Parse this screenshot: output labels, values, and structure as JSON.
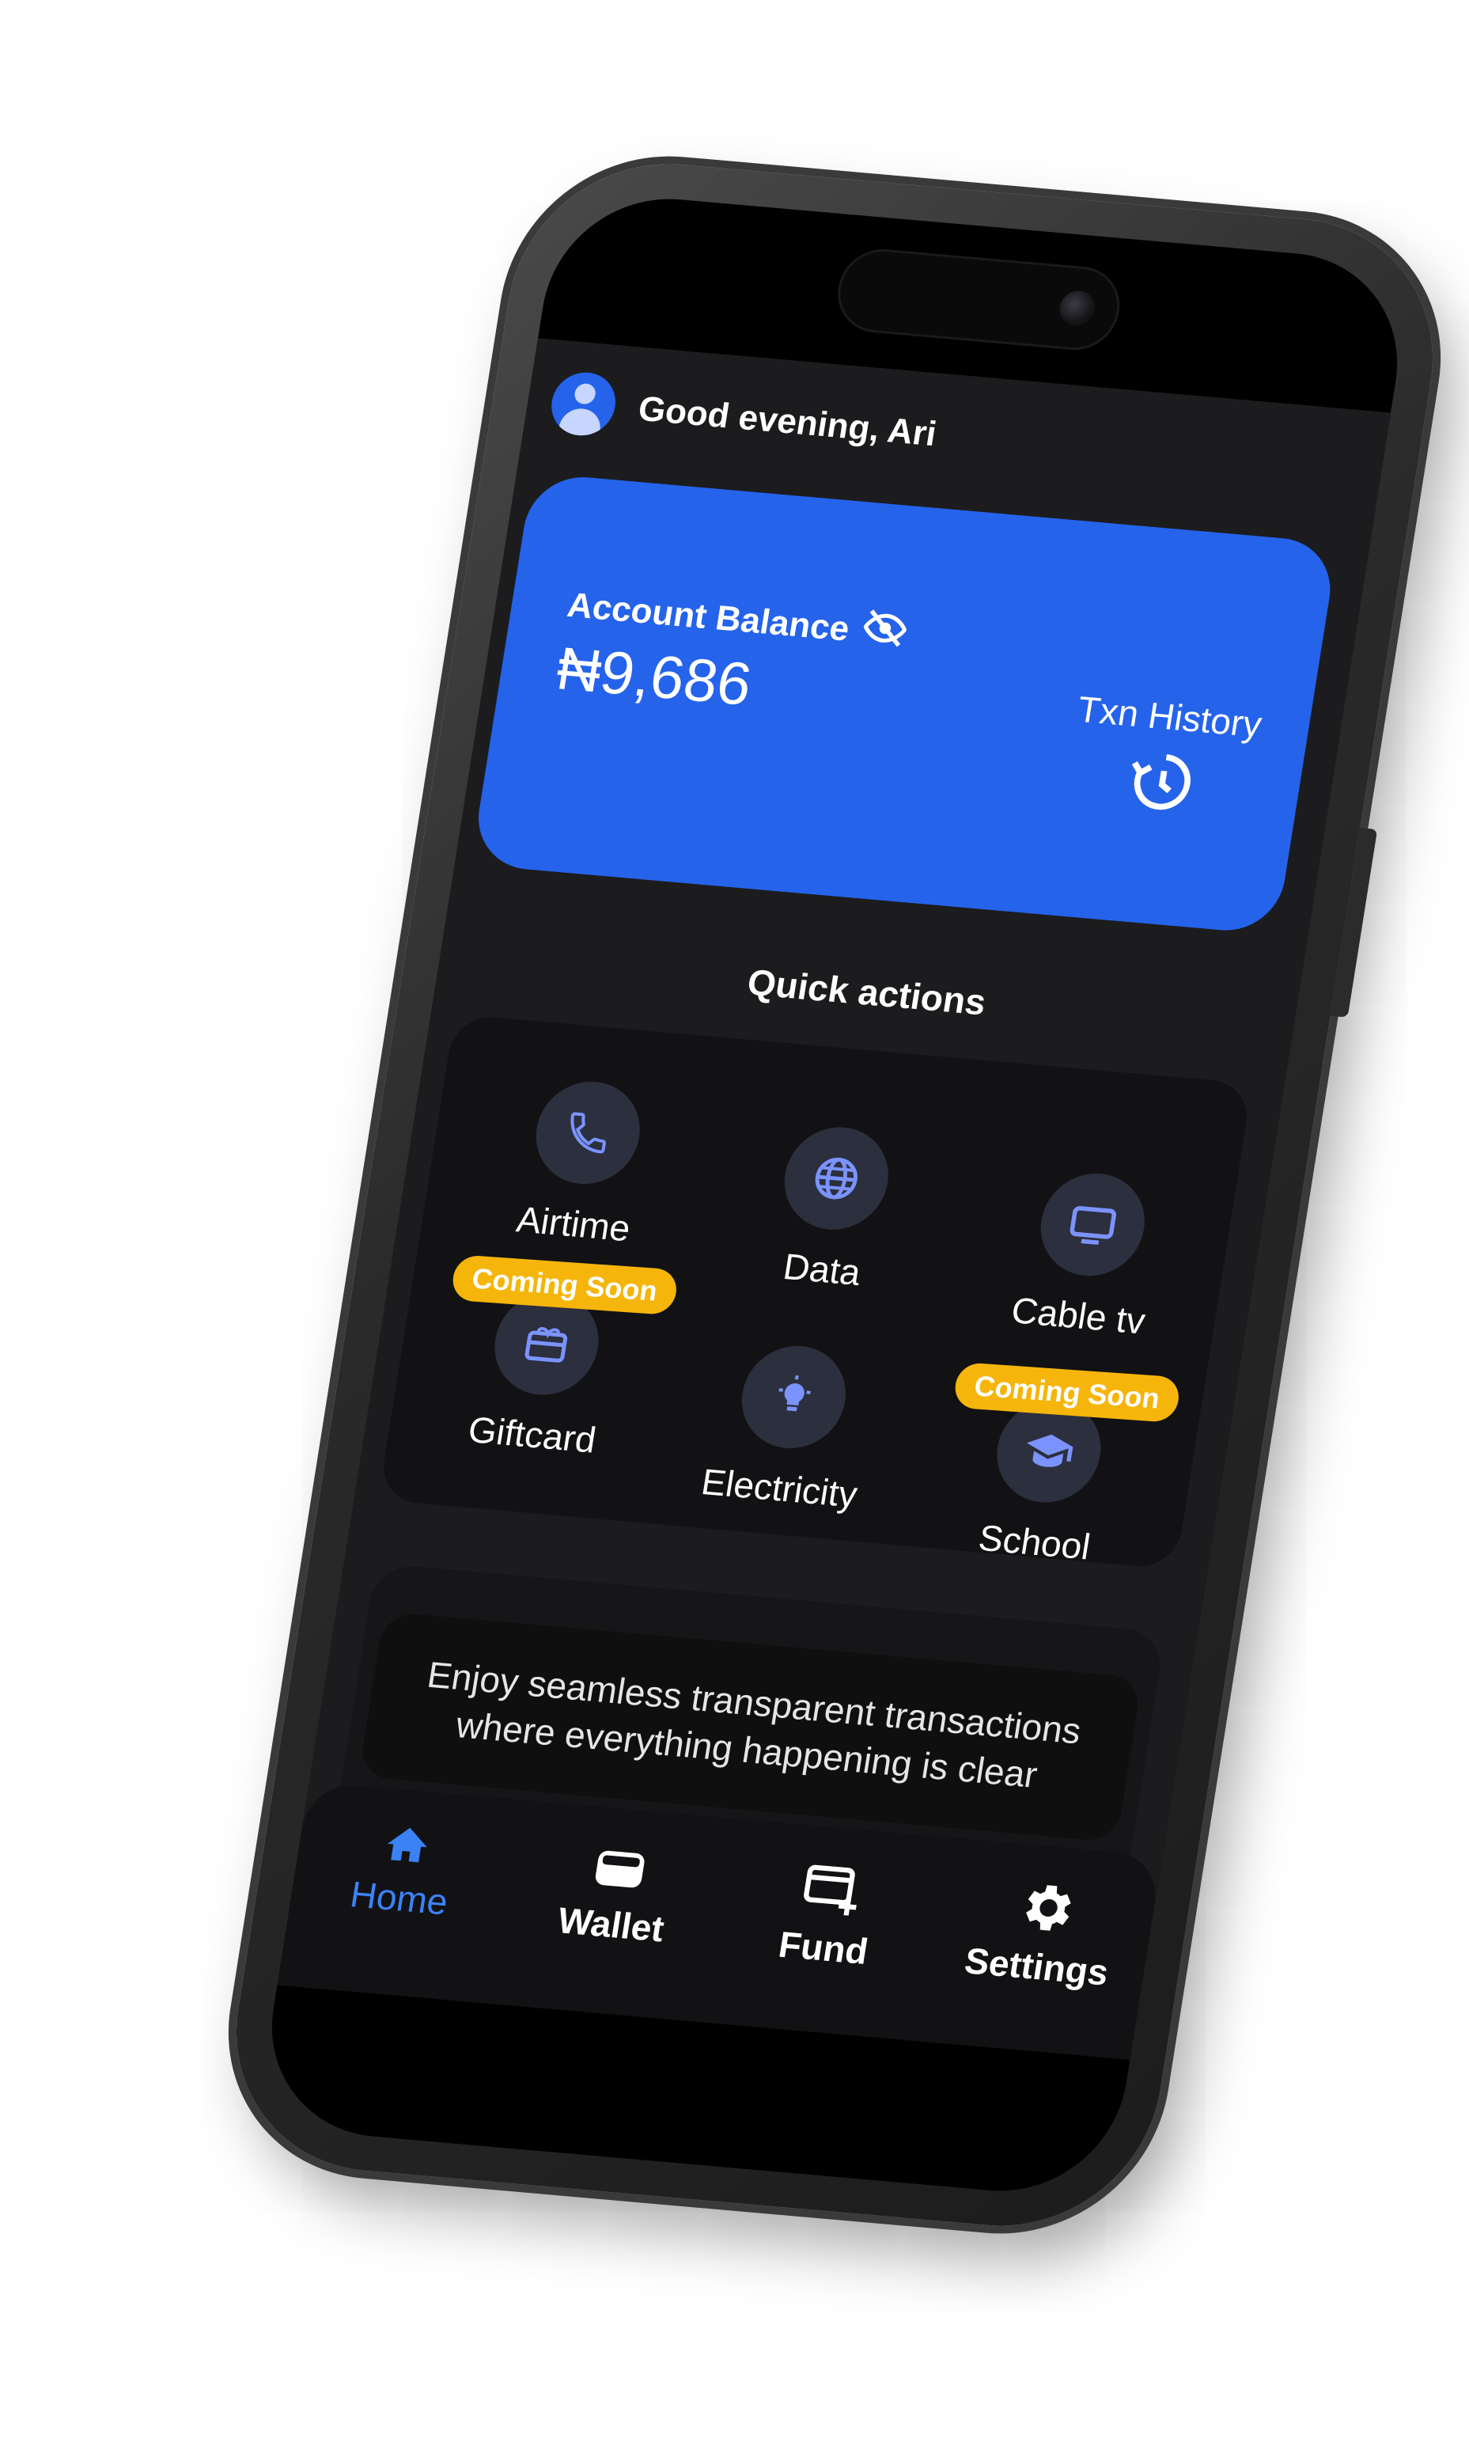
{
  "header": {
    "greeting": "Good evening, Ari",
    "avatar_icon": "user-circle-icon"
  },
  "balance_card": {
    "label": "Account Balance",
    "hide_icon": "eye-off-icon",
    "value": "₦9,686",
    "history_label": "Txn History",
    "history_icon": "history-icon",
    "color": "#2563eb"
  },
  "quick_actions": {
    "title": "Quick actions",
    "items": [
      {
        "label": "Airtime",
        "icon": "phone-icon"
      },
      {
        "label": "Data",
        "icon": "globe-icon"
      },
      {
        "label": "Cable tv",
        "icon": "tv-icon"
      },
      {
        "label": "Giftcard",
        "icon": "gift-card-icon",
        "badge": "Coming Soon"
      },
      {
        "label": "Electricity",
        "icon": "bulb-icon"
      },
      {
        "label": "School",
        "icon": "graduation-cap-icon",
        "badge": "Coming Soon"
      }
    ],
    "badge_color": "#f5b50a"
  },
  "promo": {
    "text": "Enjoy seamless transparent transactions where everything happening is clear",
    "active_slide": 1,
    "slide_count": 3
  },
  "tabbar": {
    "tabs": [
      {
        "label": "Home",
        "icon": "home-icon",
        "active": true
      },
      {
        "label": "Wallet",
        "icon": "wallet-icon",
        "active": false
      },
      {
        "label": "Fund",
        "icon": "card-add-icon",
        "active": false
      },
      {
        "label": "Settings",
        "icon": "gear-icon",
        "active": false
      }
    ],
    "active_color": "#3b82f6"
  }
}
